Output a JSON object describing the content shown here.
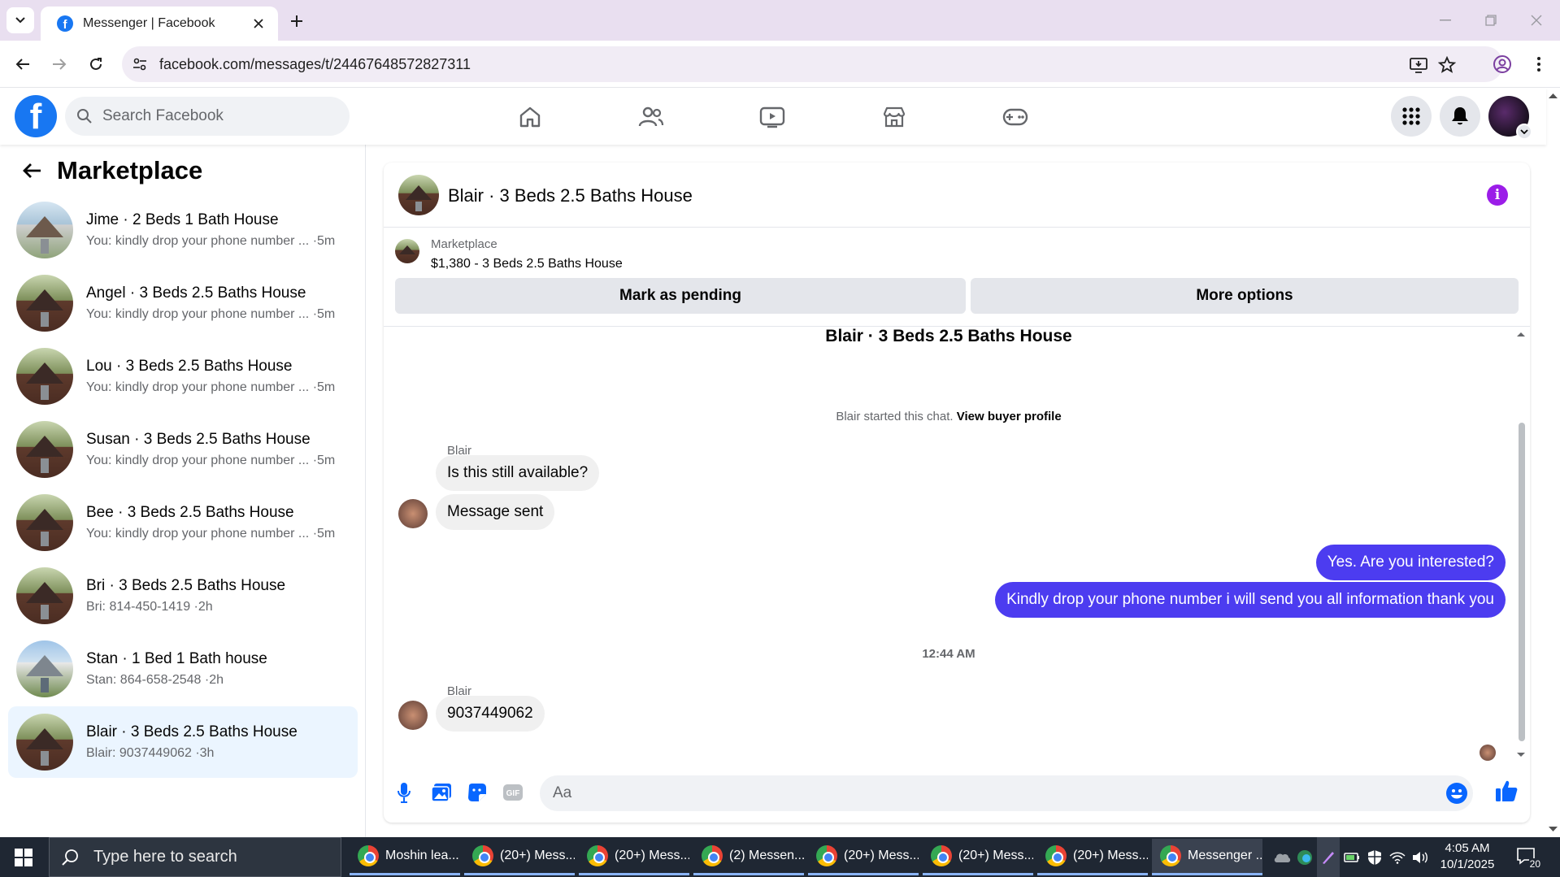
{
  "browser": {
    "tab_title": "Messenger | Facebook",
    "url": "facebook.com/messages/t/24467648572827311"
  },
  "facebook": {
    "search_placeholder": "Search Facebook"
  },
  "sidebar": {
    "title": "Marketplace",
    "conversations": [
      {
        "name": "Jime · 2 Beds 1 Bath House",
        "preview": "You: kindly drop your phone number ... ·5m"
      },
      {
        "name": "Angel · 3 Beds 2.5 Baths House",
        "preview": "You: kindly drop your phone number ... ·5m"
      },
      {
        "name": "Lou · 3 Beds 2.5 Baths House",
        "preview": "You: kindly drop your phone number ... ·5m"
      },
      {
        "name": "Susan · 3 Beds 2.5 Baths House",
        "preview": "You: kindly drop your phone number ... ·5m"
      },
      {
        "name": "Bee · 3 Beds 2.5 Baths House",
        "preview": "You: kindly drop your phone number ... ·5m"
      },
      {
        "name": "Bri · 3 Beds 2.5 Baths House",
        "preview": "Bri: 814-450-1419 ·2h"
      },
      {
        "name": "Stan · 1 Bed 1 Bath house",
        "preview": "Stan: 864-658-2548 ·2h"
      },
      {
        "name": "Blair · 3 Beds 2.5 Baths House",
        "preview": "Blair: 9037449062 ·3h"
      }
    ]
  },
  "chat": {
    "title": "Blair · 3 Beds 2.5 Baths House",
    "marketplace_label": "Marketplace",
    "listing": "$1,380 - 3 Beds 2.5 Baths House",
    "mark_pending": "Mark as pending",
    "more_options": "More options",
    "top_name": "Blair · 3 Beds 2.5 Baths House",
    "started_text": "Blair started this chat.",
    "view_profile": "View buyer profile",
    "sender1": "Blair",
    "msg1": "Is this still available?",
    "msg2": "Message sent",
    "out1": "Yes. Are you interested?",
    "out2": "Kindly drop your phone number i will send you all information thank you",
    "timestamp": "12:44 AM",
    "sender2": "Blair",
    "msg3": "9037449062",
    "input_placeholder": "Aa"
  },
  "taskbar": {
    "search_placeholder": "Type here to search",
    "apps": [
      "Moshin lea...",
      "(20+) Mess...",
      "(20+) Mess...",
      "(2) Messen...",
      "(20+) Mess...",
      "(20+) Mess...",
      "(20+) Mess...",
      "Messenger ..."
    ],
    "time": "4:05 AM",
    "date": "10/1/2025",
    "notification_count": "20"
  },
  "colors": {
    "facebook_blue": "#1877f2",
    "outgoing_bubble": "#4c3cf0",
    "active_conversation": "#ebf5ff",
    "info_icon": "#9b1de8"
  }
}
